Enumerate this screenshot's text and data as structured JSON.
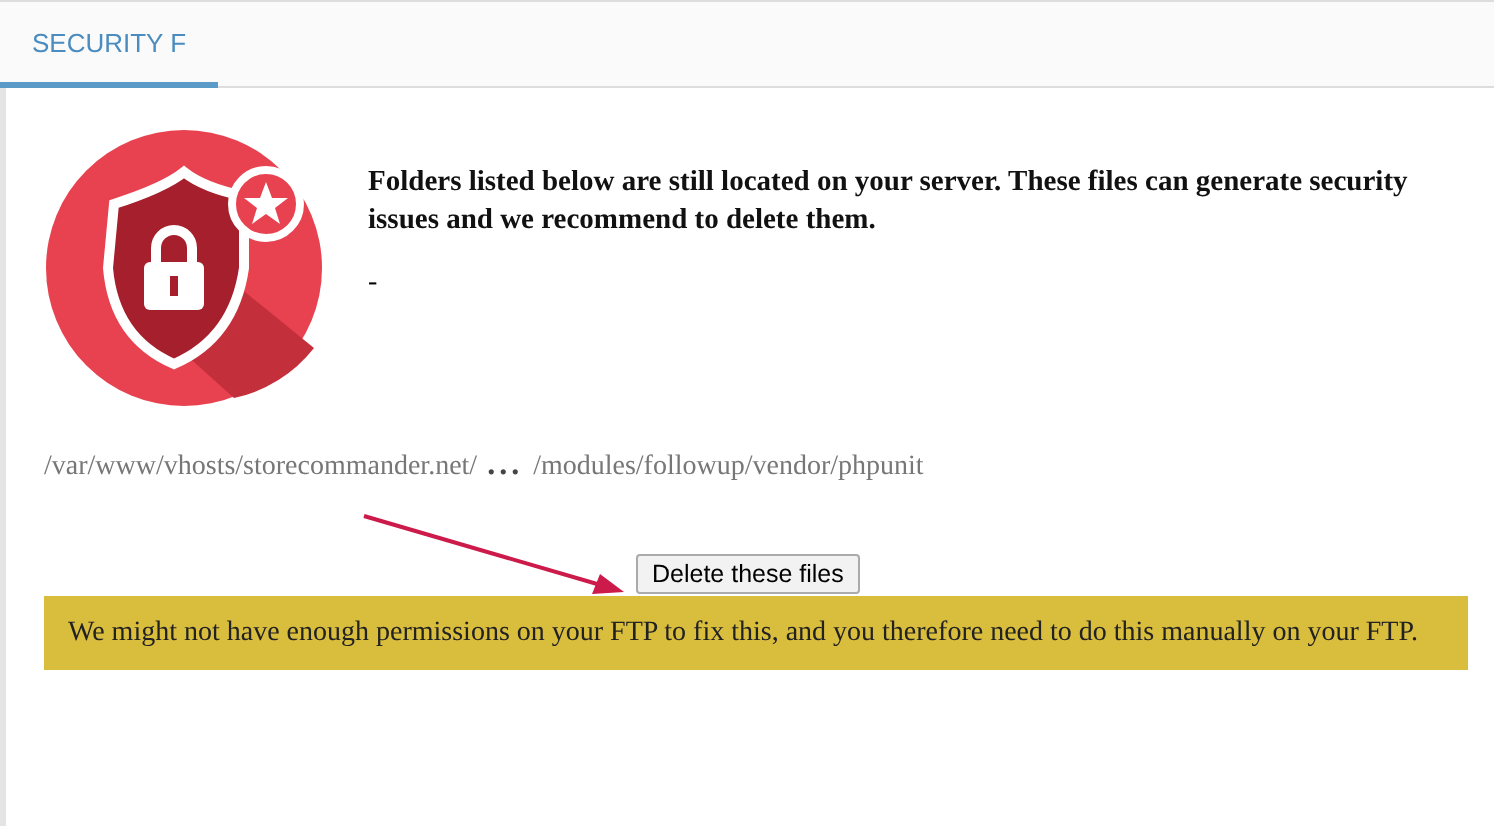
{
  "tabs": [
    {
      "label": "SECURITY F",
      "selected": true
    }
  ],
  "message": "Folders listed below are still located on your server. These files can generate security issues and we recommend to delete them.",
  "separator": "-",
  "path": {
    "start": "/var/www/vhosts/storecommander.net/",
    "ellipsis": "...",
    "end": "/modules/followup/vendor/phpunit"
  },
  "button": "Delete these files",
  "warning": "We might not have enough permissions on your FTP to fix this, and you therefore need to do this manually on your FTP."
}
